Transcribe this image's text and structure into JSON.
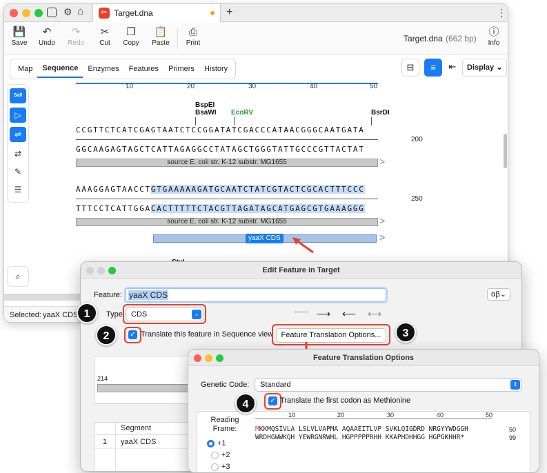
{
  "window": {
    "tab_title": "Target.dna",
    "new_tab": "+",
    "more": "⋮"
  },
  "toolbar": {
    "save": "Save",
    "undo": "Undo",
    "redo": "Redo",
    "cut": "Cut",
    "copy": "Copy",
    "paste": "Paste",
    "print": "Print",
    "info": "Info",
    "filename": "Target.dna",
    "size": "(662 bp)"
  },
  "tabs": [
    "Map",
    "Sequence",
    "Enzymes",
    "Features",
    "Primers",
    "History"
  ],
  "active_tab": "Sequence",
  "display_label": "Display",
  "tool_sall": "SalI",
  "ruler": {
    "ticks": [
      "10",
      "20",
      "30",
      "40",
      "50"
    ]
  },
  "block1": {
    "enzymes": [
      "BspEI",
      "BsaWI",
      "EcoRV",
      "BsrDI"
    ],
    "top": "CCGTTCTCATCGAGTAATCTCCGGATATCGACCCATAACGGGCAATGATA",
    "bottom": "GGCAAGAGTAGCTCATTAGAGGCCTATAGCTGGGTATTGCCCGTTACTAT",
    "pos": "200",
    "feature": "source E. coli str. K-12 substr. MG1655"
  },
  "block2": {
    "top_plain": "AAAGGAGTAACCT",
    "top_hl": "GTGAAAAAGATGCAATCTATCGTACTCGCACTTTCCC",
    "bottom_plain": "TTTCCTCATTGGA",
    "bottom_hl": "CACTTTTTCTACGTTAGATAGCATGAGCGTGAAAGGG",
    "pos": "250",
    "feature": "source E. coli str. K-12 substr. MG1655",
    "cds": "yaaX CDS",
    "enz_partial": "StyI"
  },
  "status": {
    "label": "Selected:",
    "value": "yaaX CDS"
  },
  "edit_dialog": {
    "title": "Edit Feature in Target",
    "feature_label": "Feature:",
    "feature_value": "yaaX CDS",
    "greek": "αβ",
    "type_label": "Type:",
    "type_value": "CDS",
    "translate_label": "Translate this feature in Sequence view",
    "options_button": "Feature Translation Options...",
    "start_pos": "214",
    "segment_header": "Segment",
    "segment_row": {
      "num": "1",
      "name": "yaaX CDS"
    }
  },
  "trans_dialog": {
    "title": "Feature Translation Options",
    "genetic_code_label": "Genetic Code:",
    "genetic_code_value": "Standard",
    "methionine_label": "Translate the first codon as Methionine",
    "reading_frame_label": "Reading Frame:",
    "frames": [
      "+1",
      "+2",
      "+3"
    ],
    "ruler": [
      "10",
      "20",
      "30",
      "40",
      "50"
    ],
    "line1_first": "M",
    "line1_rest": "KKMQSIVLA LSLVLVAPMA AQAAEITLVP SVKLQIGDRD NRGYYWDGGH",
    "line1_num": "50",
    "line2": "WRDHGWWKQH YEWRGNRWHL HGPPPPPRHH KKAPHDHHGG HGPGKHHR*",
    "line2_num": "99"
  },
  "steps": [
    "1",
    "2",
    "3",
    "4"
  ],
  "colors": {
    "accent": "#1a7cf4",
    "annotation": "#e8412c",
    "highlight": "#c6dcf6",
    "enzyme_green": "#2a9a2a"
  }
}
